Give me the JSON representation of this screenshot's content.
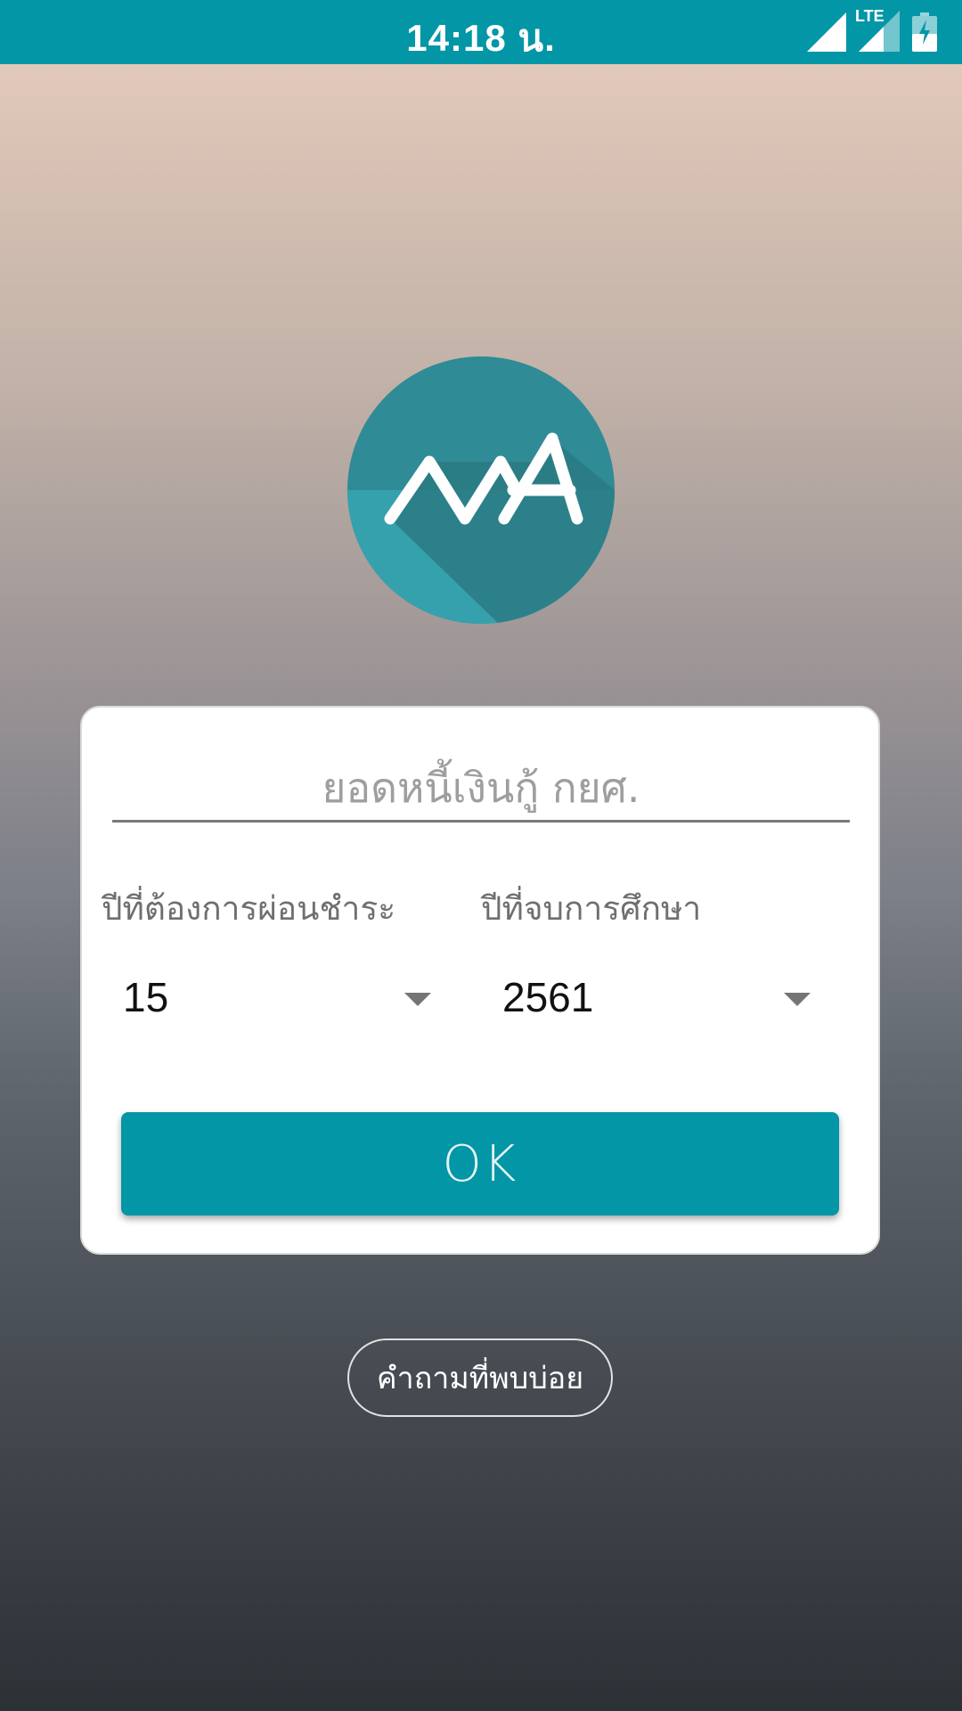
{
  "status_bar": {
    "time": "14:18 น.",
    "network_label": "LTE",
    "icons": [
      "signal-icon",
      "lte-signal-icon",
      "battery-charging-icon"
    ],
    "background_color": "#0296a6"
  },
  "logo": {
    "icon": "app-logo-icon",
    "circle_color": "#2f8b95"
  },
  "form": {
    "loan_amount_placeholder": "ยอดหนี้เงินกู้ กยศ.",
    "loan_amount_value": "",
    "installment_years_label": "ปีที่ต้องการผ่อนชำระ",
    "installment_years_value": "15",
    "graduation_year_label": "ปีที่จบการศึกษา",
    "graduation_year_value": "2561",
    "ok_label": "OK",
    "accent_color": "#0296a6"
  },
  "faq_button_label": "คำถามที่พบบ่อย"
}
